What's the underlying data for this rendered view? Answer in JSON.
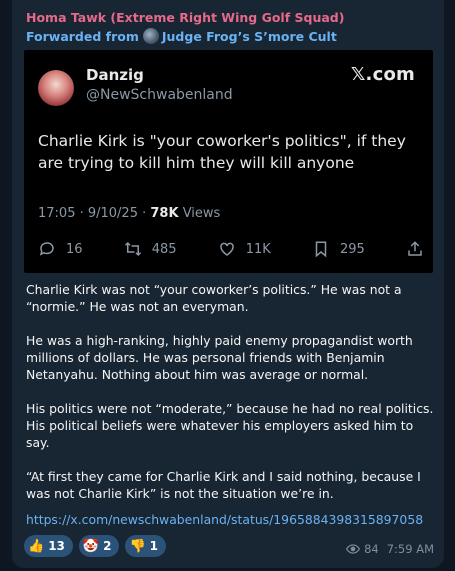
{
  "channel_name": "Homa Tawk (Extreme Right Wing Golf Squad)",
  "forwarded_prefix": "Forwarded from",
  "forwarded_source": "Judge Frog’s S’more Cult",
  "tweet": {
    "display_name": "Danzig",
    "handle": "@NewSchwabenland",
    "site": "𝕏.com",
    "text": "Charlie Kirk is \"your coworker's politics\", if they are trying to kill him they will kill anyone",
    "time": "17:05 · 9/10/25 ·",
    "views_count": "78K",
    "views_label": "Views",
    "replies": "16",
    "retweets": "485",
    "likes": "11K",
    "bookmarks": "295"
  },
  "message": {
    "paragraphs": [
      "Charlie Kirk was not “your coworker’s politics.” He was not a “normie.” He was not an everyman.",
      "He was a high-ranking, highly paid enemy propagandist worth millions of dollars. He was personal friends with Benjamin Netanyahu. Nothing about him was average or normal.",
      "His politics were not “moderate,” because he had no real politics. His political beliefs were whatever his employers asked him to say.",
      "“At first they came for Charlie Kirk and I said nothing, because I was not Charlie Kirk” is not the situation we’re in."
    ],
    "link": "https://x.com/newschwabenland/status/1965884398315897058"
  },
  "reactions": [
    {
      "emoji": "👍",
      "count": "13"
    },
    {
      "emoji": "🤡",
      "count": "2"
    },
    {
      "emoji": "👎",
      "count": "1"
    }
  ],
  "views": "84",
  "time": "7:59 AM"
}
